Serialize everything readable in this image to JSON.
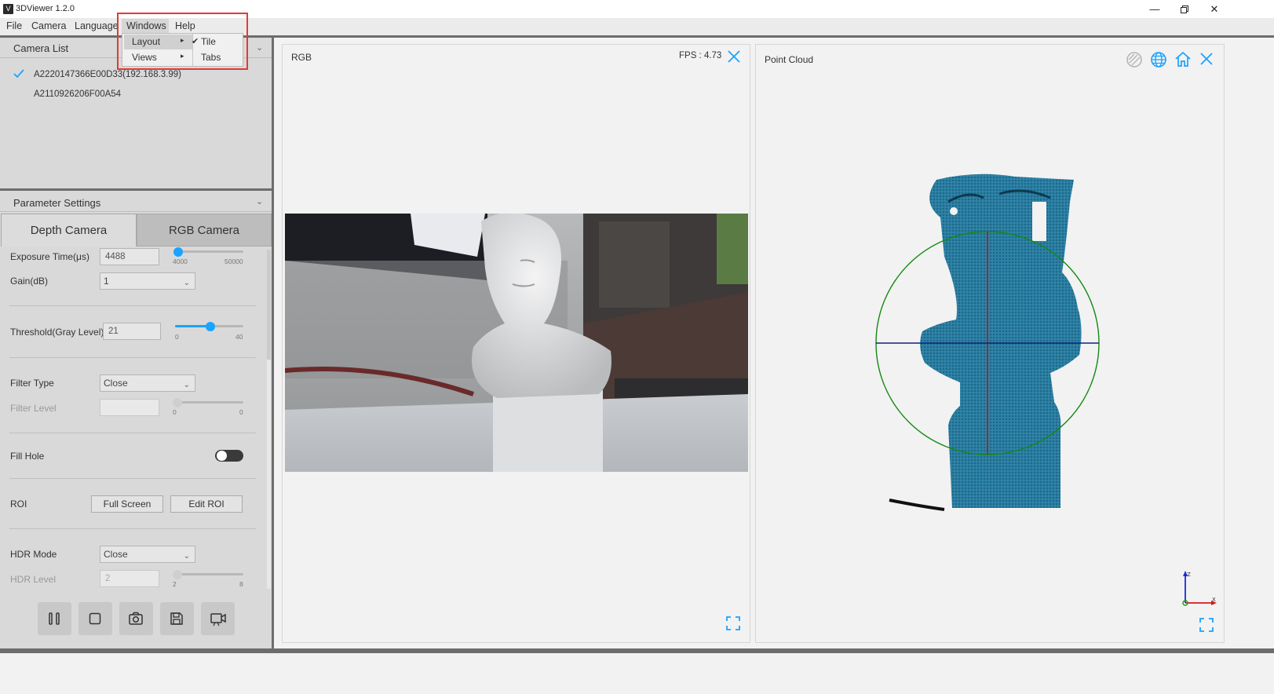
{
  "window": {
    "title": "3DViewer 1.2.0",
    "logo": "V"
  },
  "menubar": {
    "items": [
      "File",
      "Camera",
      "Language",
      "Windows",
      "Help"
    ]
  },
  "windows_menu": {
    "items": [
      {
        "label": "Layout",
        "submenu_arrow": "▸"
      },
      {
        "label": "Views",
        "submenu_arrow": "▸"
      }
    ],
    "layout_submenu": [
      {
        "label": "Tile",
        "checked": true
      },
      {
        "label": "Tabs",
        "checked": false
      }
    ]
  },
  "camera_list": {
    "title": "Camera List",
    "cameras": [
      {
        "label": "A2220147366E00D33(192.168.3.99)",
        "selected": true
      },
      {
        "label": "A2110926206F00A54",
        "selected": false
      }
    ]
  },
  "parameter_settings": {
    "title": "Parameter Settings",
    "tabs": [
      "Depth Camera",
      "RGB Camera"
    ],
    "active_tab": "Depth Camera",
    "exposure": {
      "label": "Exposure Time(μs)",
      "value": "4488",
      "min": "4000",
      "max": "50000",
      "level": 0.01
    },
    "gain": {
      "label": "Gain(dB)",
      "value": "1"
    },
    "threshold": {
      "label": "Threshold(Gray Level)",
      "value": "21",
      "min": "0",
      "max": "40",
      "level": 0.525
    },
    "filter_type": {
      "label": "Filter Type",
      "value": "Close"
    },
    "filter_level": {
      "label": "Filter Level",
      "value": "",
      "min": "0",
      "max": "0",
      "level": 0
    },
    "fill_hole": {
      "label": "Fill Hole",
      "enabled": false
    },
    "roi": {
      "label": "ROI",
      "full_screen": "Full Screen",
      "edit_roi": "Edit ROI"
    },
    "hdr_mode": {
      "label": "HDR Mode",
      "value": "Close"
    },
    "hdr_level": {
      "label": "HDR Level",
      "value": "2",
      "min": "2",
      "max": "8",
      "level": 0
    }
  },
  "toolbar": {
    "icons": [
      "pause-icon",
      "stop-icon",
      "camera-icon",
      "save-icon",
      "record-icon"
    ]
  },
  "rgb_view": {
    "title": "RGB",
    "fps": "FPS : 4.73"
  },
  "point_cloud_view": {
    "title": "Point Cloud",
    "icons": [
      "wireframe-icon",
      "globe-icon",
      "home-icon",
      "close-icon"
    ]
  },
  "colors": {
    "accent": "#1aa3ff",
    "point_cloud": "#1e6f8f",
    "highlight": "#e53935"
  }
}
